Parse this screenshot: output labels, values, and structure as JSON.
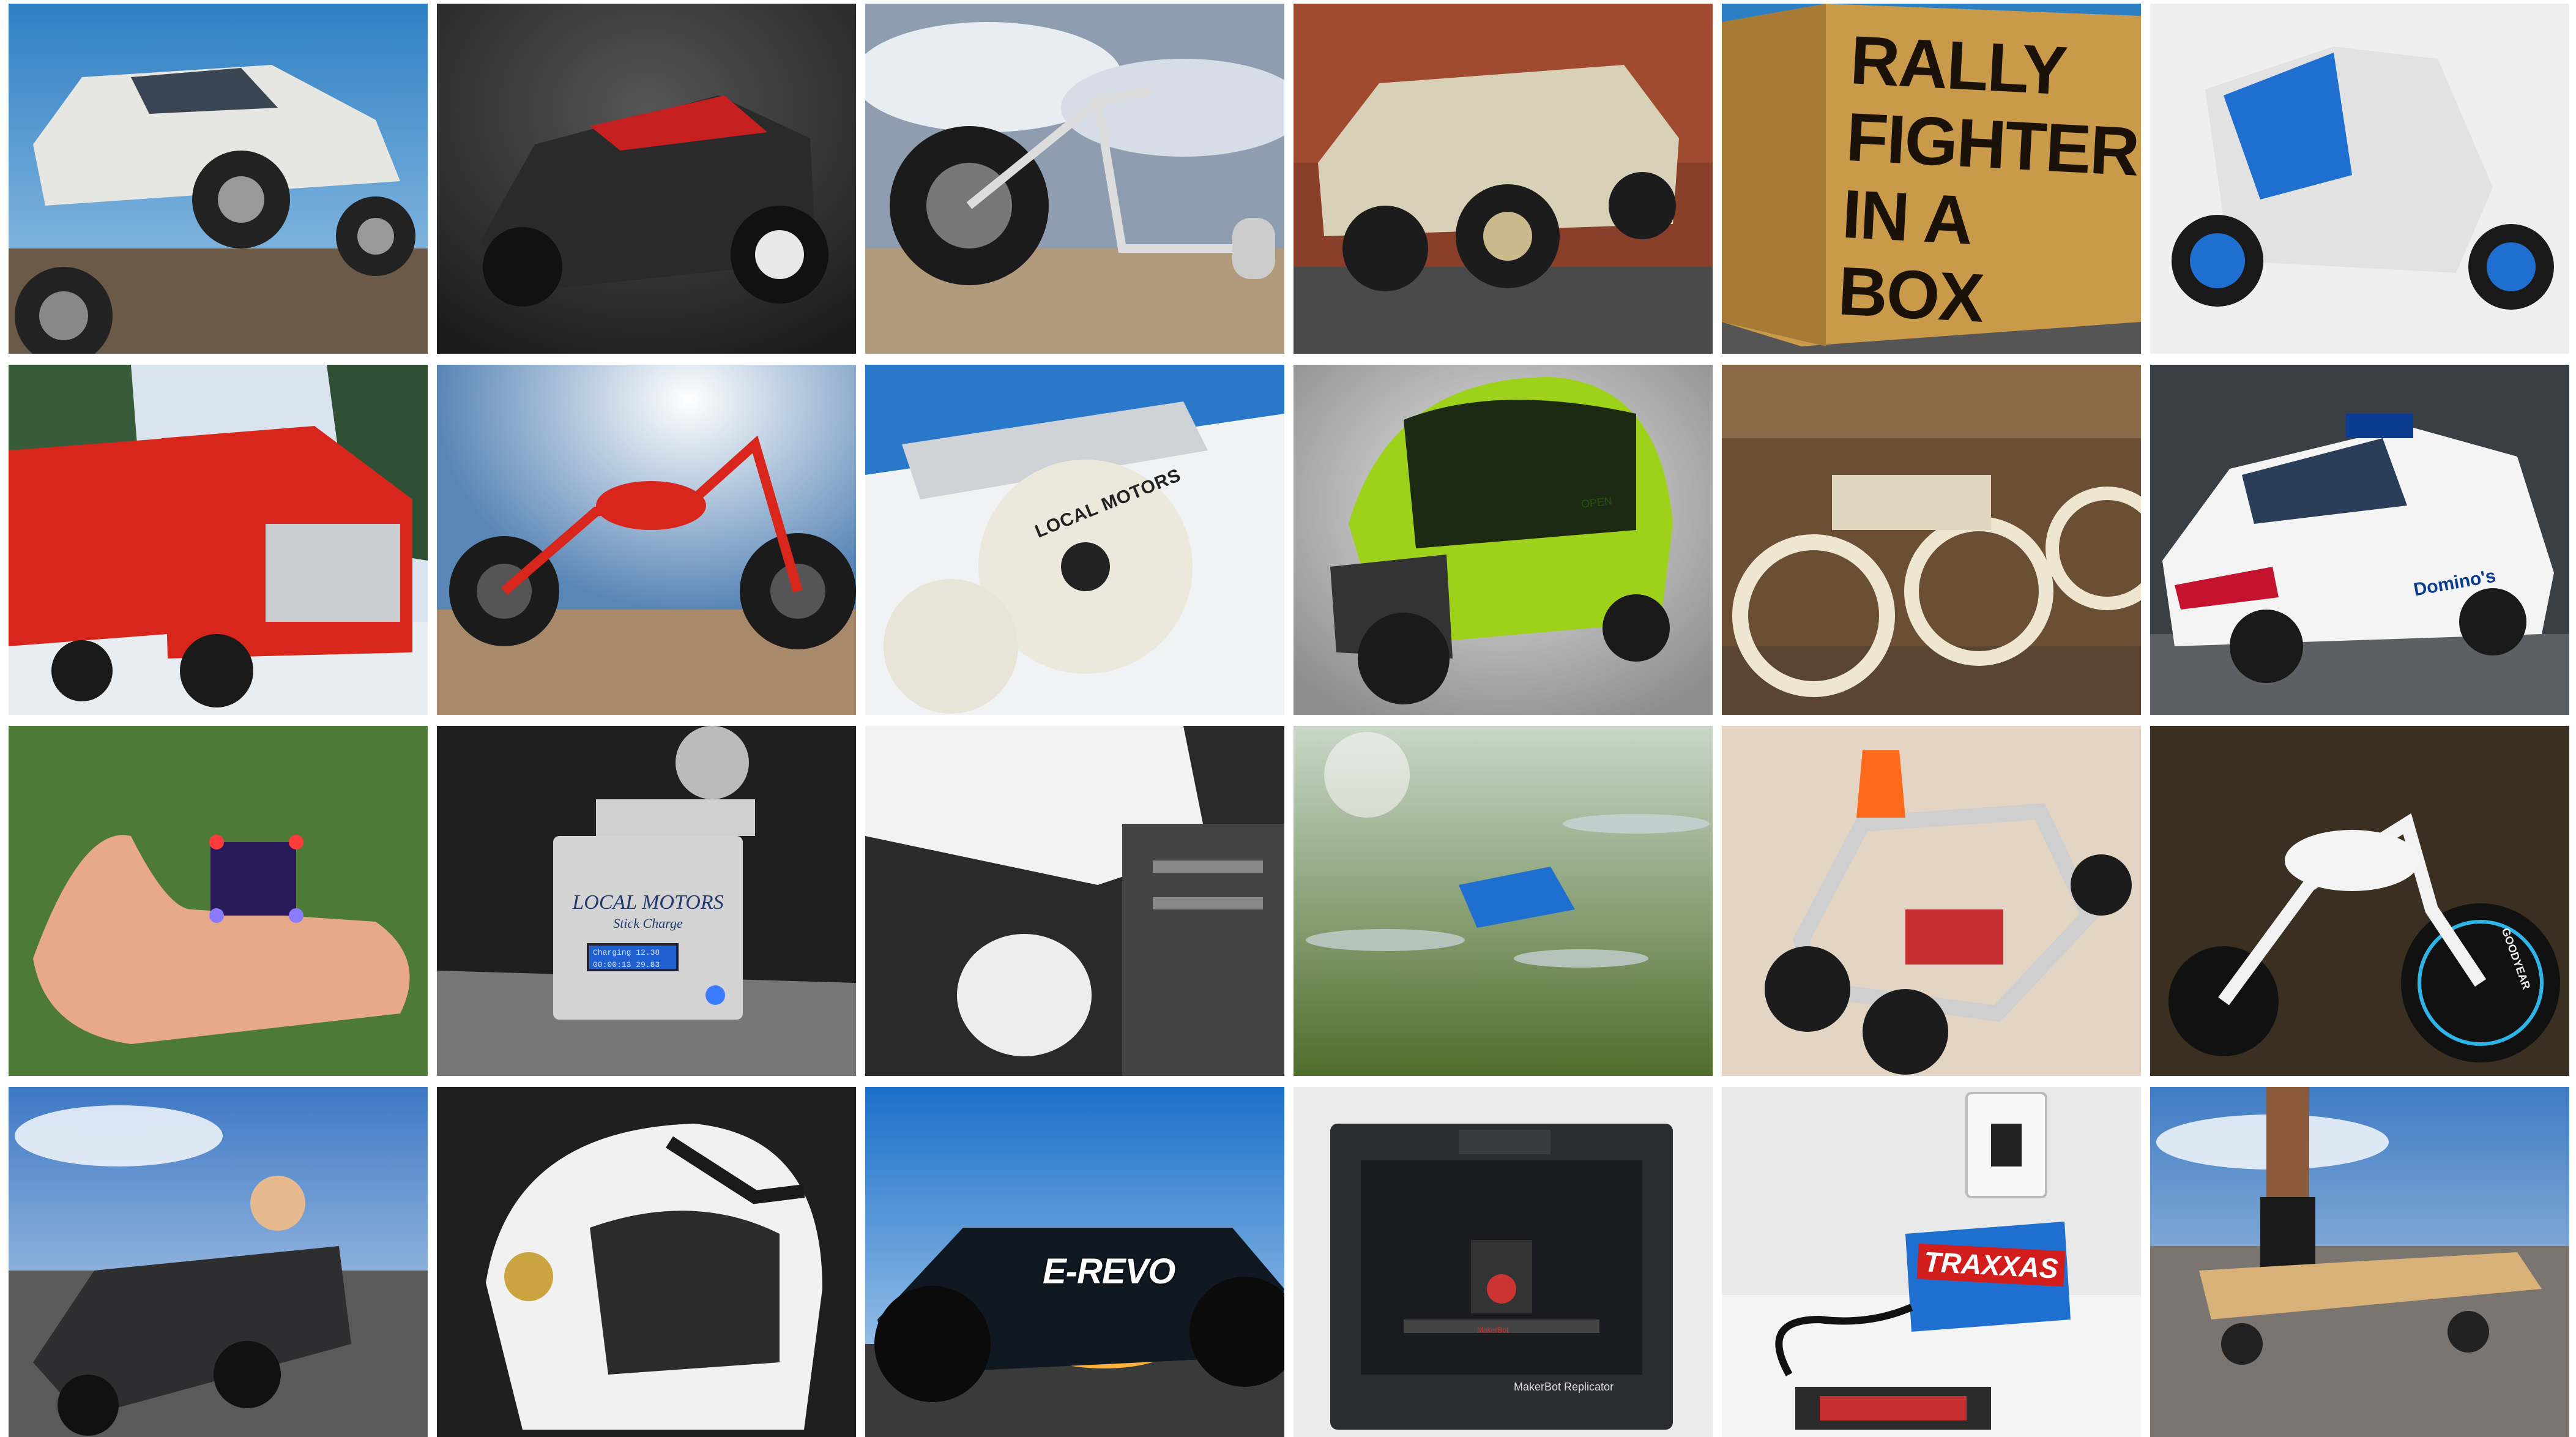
{
  "gallery": {
    "columns": 6,
    "rows": 4,
    "tiles": [
      {
        "subject": "Rally Fighter off-road truck jumping"
      },
      {
        "subject": "Black 3D-printed car with red seats"
      },
      {
        "subject": "Drift trike on desert road"
      },
      {
        "subject": "Military-style off-road vehicle"
      },
      {
        "subject": "Rally Fighter in a box crate",
        "text": [
          "RALLY",
          "FIGHTER",
          "IN A BOX"
        ]
      },
      {
        "subject": "Three-wheeled blue enclosed vehicle"
      },
      {
        "subject": "Red semi truck in snow"
      },
      {
        "subject": "Red chopper motorcycle"
      },
      {
        "subject": "Skateboard truck with Local Motors wheel",
        "text": [
          "LOCAL MOTORS"
        ]
      },
      {
        "subject": "Green two-seat pod electric car",
        "text": [
          "OPEN"
        ]
      },
      {
        "subject": "Vintage board-track motorcycles"
      },
      {
        "subject": "Domino's delivery car",
        "text": [
          "Domino's"
        ]
      },
      {
        "subject": "Mini quadcopter on a hand"
      },
      {
        "subject": "Local Motors Stick Charge box",
        "text": [
          "LOCAL MOTORS",
          "Stick Charge"
        ]
      },
      {
        "subject": "White motorcycle engine close-up"
      },
      {
        "subject": "Blue quadcopter drone in flight"
      },
      {
        "subject": "Orange-topped go-kart frame"
      },
      {
        "subject": "White custom motorcycle",
        "text": [
          "GOODYEAR"
        ]
      },
      {
        "subject": "Child in black toy sports car"
      },
      {
        "subject": "Black and gold motorcycle helmet"
      },
      {
        "subject": "E-Revo RC truck at sunset",
        "text": [
          "E-REVO"
        ]
      },
      {
        "subject": "MakerBot Replicator 3D printer",
        "text": [
          "MakerBot Replicator"
        ]
      },
      {
        "subject": "Traxxas battery charger",
        "text": [
          "TRAXXAS"
        ]
      },
      {
        "subject": "Electric skateboard on road"
      }
    ]
  },
  "texts": {
    "crate_line1": "RALLY",
    "crate_line2": "FIGHTER",
    "crate_line3": "IN A BOX",
    "wheel_brand": "LOCAL MOTORS",
    "charger_brand": "LOCAL MOTORS",
    "charger_sub": "Stick Charge",
    "lcd_line1": "Charging  12.38",
    "lcd_line2": "00:00:13  29.83",
    "pod_label": "OPEN",
    "delivery_brand": "Domino's",
    "tire_brand": "GOODYEAR",
    "rc_brand": "E-REVO",
    "printer_name": "MakerBot Replicator",
    "printer_small": "MakerBot",
    "charger2_brand": "TRAXXAS"
  },
  "colors": {
    "background": "#ffffff",
    "crate_wood": "#c99a4a",
    "truck_red": "#d9261c",
    "drone_blue": "#1f6fd1",
    "pod_green": "#9ed21a"
  }
}
